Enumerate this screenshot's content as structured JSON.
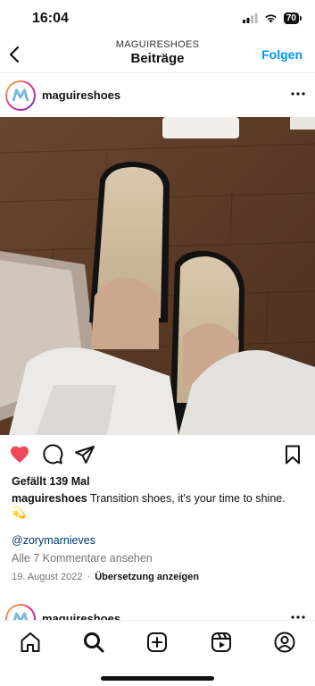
{
  "status": {
    "time": "16:04",
    "battery": "70"
  },
  "nav": {
    "subtitle": "MAGUIRESHOES",
    "title": "Beiträge",
    "follow_label": "Folgen"
  },
  "post": {
    "username": "maguireshoes",
    "likes": "Gefällt 139 Mal",
    "caption_user": "maguireshoes",
    "caption_text": " Transition shoes, it's your time to shine.",
    "caption_emoji": "💫",
    "mention": "@zorymarnieves",
    "comments_link": "Alle 7 Kommentare ansehen",
    "date": "19. August 2022",
    "separator": "·",
    "translate_link": "Übersetzung anzeigen",
    "liked": true
  },
  "next_post": {
    "username": "maguireshoes"
  },
  "colors": {
    "like_red": "#ed4956",
    "link_blue": "#0095f6",
    "mention_blue": "#00376b"
  },
  "icons": {
    "back": "chevron-left-icon",
    "more": "more-horizontal-icon",
    "like": "heart-icon",
    "comment": "comment-icon",
    "share": "send-icon",
    "save": "bookmark-icon",
    "tabs": [
      "home-icon",
      "search-icon",
      "create-icon",
      "reels-icon",
      "profile-icon"
    ]
  }
}
